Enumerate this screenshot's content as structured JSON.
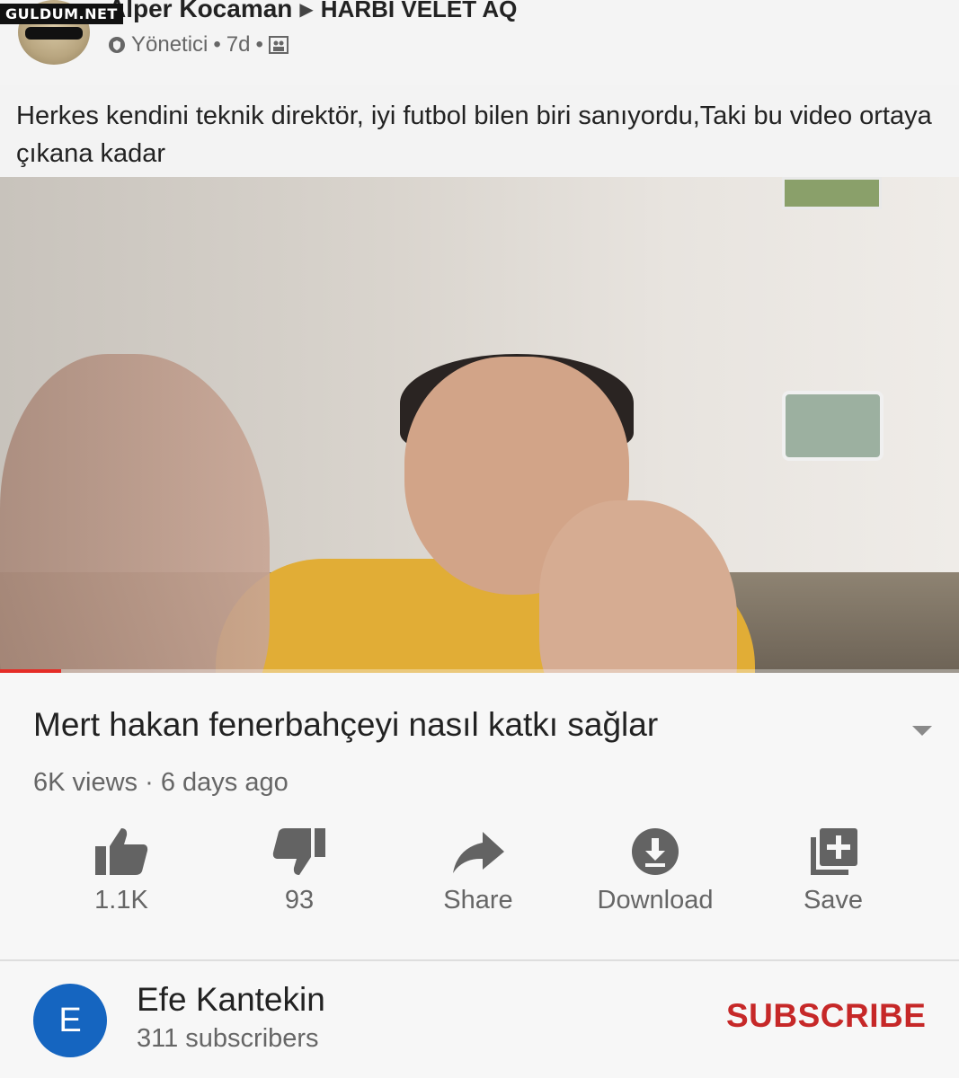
{
  "watermark": "GULDUM.NET",
  "post": {
    "author": "Alper Kocaman",
    "group": "HARBI VELET AQ",
    "role": "Yönetici",
    "time": "7d",
    "caption": "Herkes kendini teknik direktör, iyi futbol bilen biri sanıyordu,Taki bu video ortaya çıkana kadar"
  },
  "video": {
    "title": "Mert hakan fenerbahçeyi nasıl katkı sağlar",
    "views_line": "6K views · 6 days ago",
    "progress": 0.064
  },
  "actions": {
    "like_count": "1.1K",
    "dislike_count": "93",
    "share_label": "Share",
    "download_label": "Download",
    "save_label": "Save"
  },
  "channel": {
    "initial": "E",
    "name": "Efe Kantekin",
    "subscribers": "311 subscribers",
    "subscribe_label": "SUBSCRIBE"
  },
  "colors": {
    "subscribe": "#c62828",
    "avatar": "#1565c0",
    "progress": "#e52d27"
  }
}
